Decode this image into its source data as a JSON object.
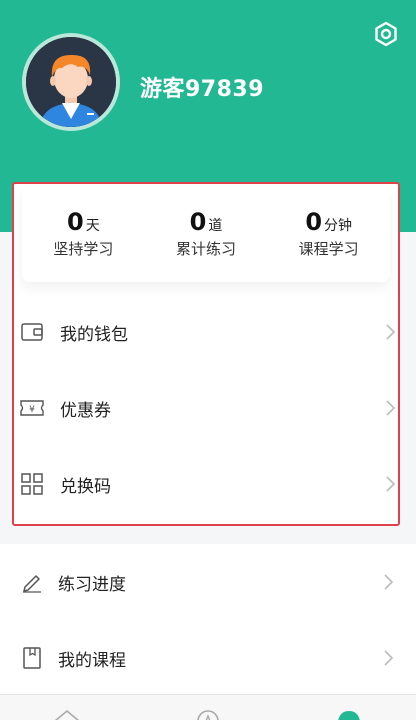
{
  "profile": {
    "username": "游客97839"
  },
  "stats": [
    {
      "value": "0",
      "unit": "天",
      "label": "坚持学习"
    },
    {
      "value": "0",
      "unit": "道",
      "label": "累计练习"
    },
    {
      "value": "0",
      "unit": "分钟",
      "label": "课程学习"
    }
  ],
  "card_menu": [
    {
      "label": "我的钱包",
      "icon": "wallet-icon"
    },
    {
      "label": "优惠券",
      "icon": "coupon-icon"
    },
    {
      "label": "兑换码",
      "icon": "qr-code-icon"
    }
  ],
  "menu": [
    {
      "label": "练习进度",
      "icon": "pencil-icon"
    },
    {
      "label": "我的课程",
      "icon": "book-icon"
    }
  ],
  "colors": {
    "accent": "#21b893",
    "highlight": "#e0404a"
  }
}
